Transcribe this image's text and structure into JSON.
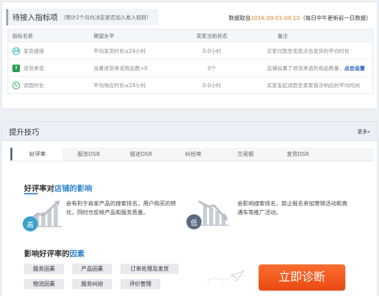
{
  "entry": {
    "title": "待接入指标项",
    "subtitle": "（预计2个月内决定是否加入准入规则）",
    "info_prefix": "数据取自",
    "info_date": "2016.09.01-09.10",
    "info_suffix": "（每日中午更新前一日数据）"
  },
  "table": {
    "headers": [
      "指标名称",
      "期望水平",
      "卖家当前状态",
      "备注"
    ],
    "rows": [
      {
        "icon": "ship-speed-icon",
        "glyph": "24",
        "name": "发货速度",
        "expect": "平均发货时长≤24小时",
        "status": "0.0小时",
        "note": "买家付款至卖家点击发货的平均时长",
        "link": ""
      },
      {
        "icon": "return-promise-icon",
        "glyph": "7",
        "name": "退货承诺",
        "expect": "设置退货承诺商品数>0",
        "status": "0个",
        "note": "店铺设置了退货承诺的商品数量，",
        "link": "点击设置"
      },
      {
        "icon": "refund-time-icon",
        "glyph": "↻",
        "name": "退款时长",
        "expect": "平均响应时长≤24小时",
        "status": "0.0小时",
        "note": "买家发起退款至卖家首次响应的平均时间",
        "link": ""
      }
    ]
  },
  "tips": {
    "title": "提升技巧",
    "more": "更多»",
    "tabs": [
      "好评率",
      "服务DSR",
      "描述DSR",
      "纠纷率",
      "交易额",
      "发货DSR"
    ],
    "impact_title_a": "好评率对",
    "impact_title_b": "店铺的影响",
    "high_badge": "高",
    "high_text": "会有利于商家产品的搜索排名，用户购买的转化，同时也反映产品和服务质量。",
    "low_badge": "低",
    "low_text": "会影响搜索排名，禁止报名参加营销活动和直通车等推广活动。",
    "factor_title_a": "影响好评率的",
    "factor_title_b": "因素",
    "factors": [
      "服务因素",
      "产品因素",
      "订单处理及发货",
      "物流因素",
      "服务纠纷",
      "评价管理"
    ],
    "cta": "立即诊断"
  },
  "colors": {
    "accent": "#2f84cf",
    "cta": "#ef5a1c",
    "high_badge": "#3aa0c8",
    "low_badge": "#5a6a82",
    "date": "#e67e22"
  }
}
